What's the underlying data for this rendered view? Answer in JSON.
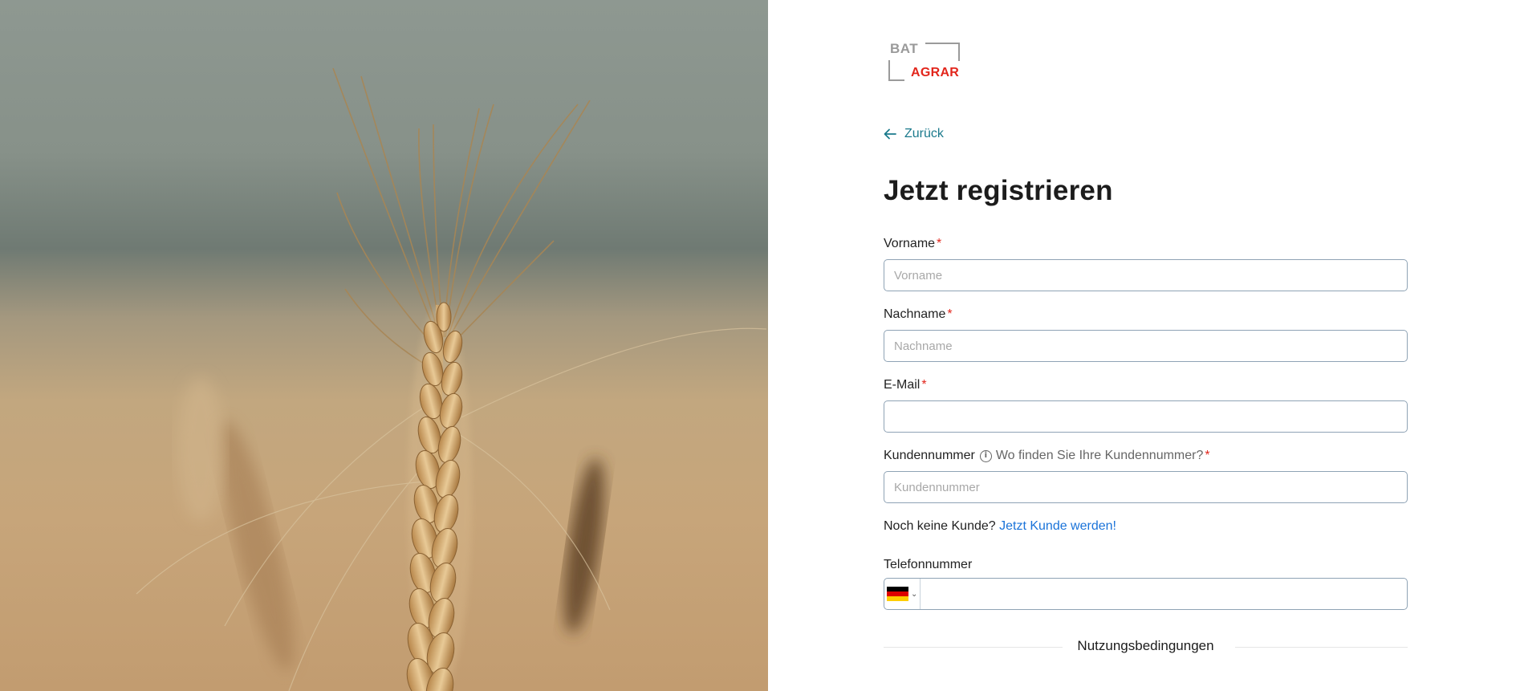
{
  "logo": {
    "top": "BAT",
    "bottom": "AGRAR"
  },
  "back_label": "Zurück",
  "title": "Jetzt registrieren",
  "required_mark": "*",
  "fields": {
    "first_name": {
      "label": "Vorname",
      "placeholder": "Vorname",
      "value": ""
    },
    "last_name": {
      "label": "Nachname",
      "placeholder": "Nachname",
      "value": ""
    },
    "email": {
      "label": "E-Mail",
      "placeholder": "",
      "value": ""
    },
    "customer_number": {
      "label": "Kundennummer",
      "hint": "Wo finden Sie Ihre Kundennummer?",
      "placeholder": "Kundennummer",
      "value": ""
    },
    "phone": {
      "label": "Telefonnummer",
      "country": "DE",
      "value": ""
    }
  },
  "no_customer": {
    "text": "Noch keine Kunde?",
    "link": "Jetzt Kunde werden!"
  },
  "terms_heading": "Nutzungsbedingungen",
  "colors": {
    "accent_teal": "#1b7a8c",
    "link_blue": "#1a73d9",
    "required_red": "#e2261c",
    "brand_red": "#e2261c"
  }
}
